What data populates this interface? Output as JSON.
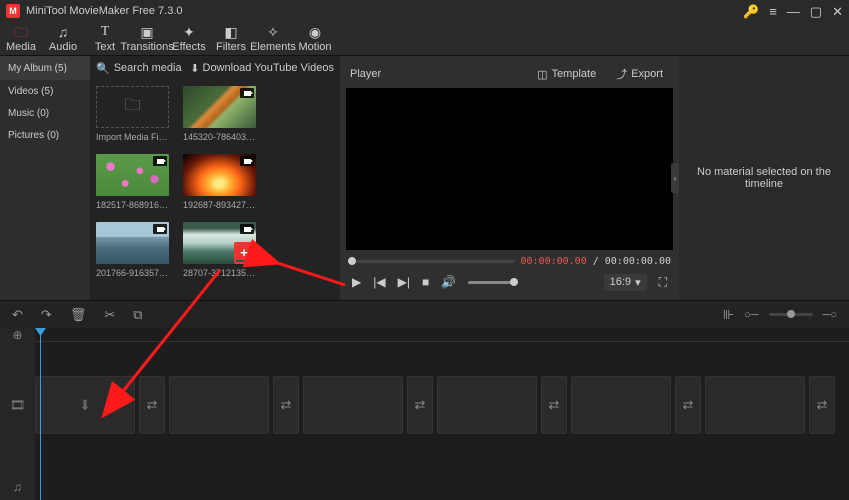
{
  "titlebar": {
    "title": "MiniTool MovieMaker Free 7.3.0"
  },
  "tools": [
    {
      "label": "Media",
      "icon": "🗀"
    },
    {
      "label": "Audio",
      "icon": "♫"
    },
    {
      "label": "Text",
      "icon": "T"
    },
    {
      "label": "Transitions",
      "icon": "▣"
    },
    {
      "label": "Effects",
      "icon": "✦"
    },
    {
      "label": "Filters",
      "icon": "◧"
    },
    {
      "label": "Elements",
      "icon": "✧"
    },
    {
      "label": "Motion",
      "icon": "◉"
    }
  ],
  "sidebar": {
    "header": "My Album (5)",
    "items": [
      "Videos (5)",
      "Music (0)",
      "Pictures (0)"
    ]
  },
  "library": {
    "search_placeholder": "Search media",
    "download": "Download YouTube Videos",
    "cells": [
      {
        "cap": "Import Media Files"
      },
      {
        "cap": "145320-786403437..."
      },
      {
        "cap": "182517-868916307..."
      },
      {
        "cap": "192687-893427276..."
      },
      {
        "cap": "201766-916357972..."
      },
      {
        "cap": "28707-371213524_t..."
      }
    ]
  },
  "player": {
    "title": "Player",
    "template": "Template",
    "export": "Export",
    "cur": "00:00:00.00",
    "sep": " / ",
    "tot": "00:00:00.00",
    "ratio": "16:9"
  },
  "inspector": {
    "msg": "No material selected on the timeline"
  }
}
